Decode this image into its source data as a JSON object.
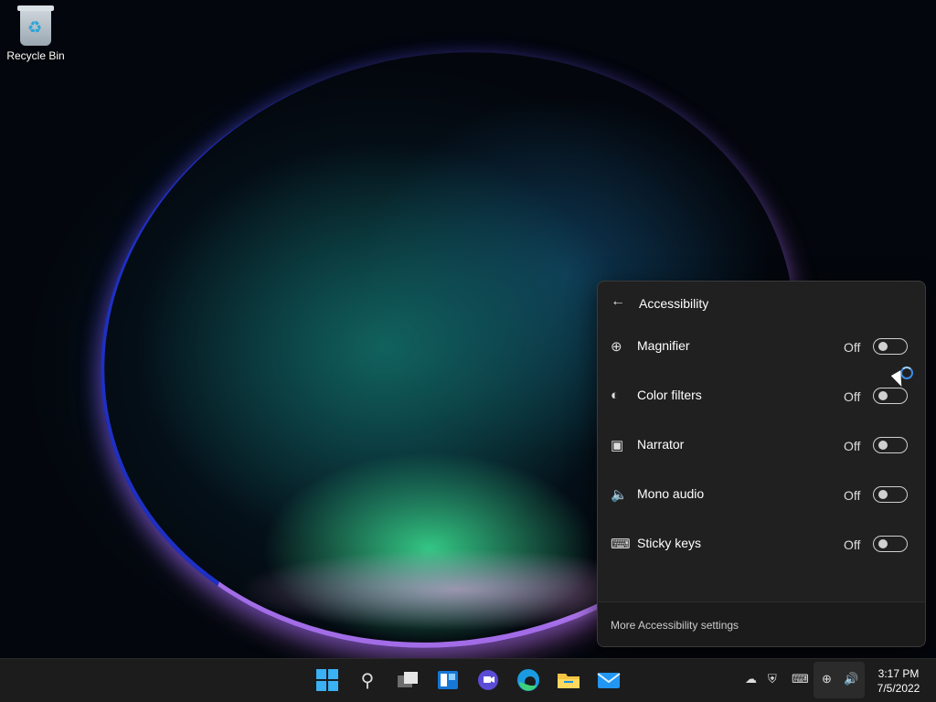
{
  "desktop": {
    "icons": [
      {
        "label": "Recycle Bin",
        "icon": "recycle-bin-icon"
      }
    ]
  },
  "accessibility_flyout": {
    "title": "Accessibility",
    "back_icon": "back-arrow-icon",
    "items": [
      {
        "label": "Magnifier",
        "state": "Off",
        "icon": "magnifier-icon",
        "on": false
      },
      {
        "label": "Color filters",
        "state": "Off",
        "icon": "color-filters-icon",
        "on": false
      },
      {
        "label": "Narrator",
        "state": "Off",
        "icon": "narrator-icon",
        "on": false
      },
      {
        "label": "Mono audio",
        "state": "Off",
        "icon": "mono-audio-icon",
        "on": false
      },
      {
        "label": "Sticky keys",
        "state": "Off",
        "icon": "sticky-keys-icon",
        "on": false
      }
    ],
    "footer_link": "More Accessibility settings"
  },
  "taskbar": {
    "apps": [
      "start-icon",
      "search-icon",
      "task-view-icon",
      "widgets-icon",
      "chat-icon",
      "edge-icon",
      "file-explorer-icon",
      "mail-icon"
    ],
    "tray": [
      "onedrive-offline-icon",
      "security-warning-icon",
      "keyboard-icon",
      "network-icon",
      "volume-icon"
    ],
    "time": "3:17 PM",
    "date": "7/5/2022"
  },
  "colors": {
    "accent": "#3ab0f5",
    "flyout_bg": "#202020",
    "taskbar_bg": "#1c1c1c"
  }
}
